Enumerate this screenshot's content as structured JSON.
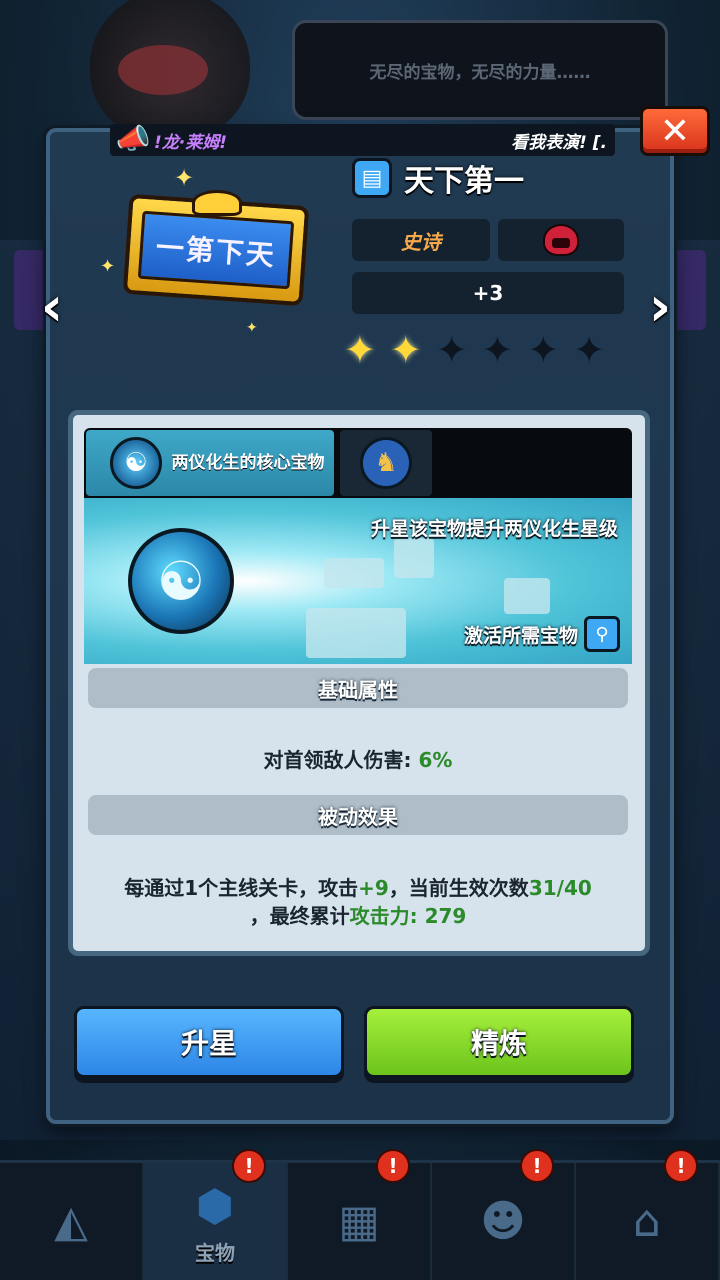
{
  "background": {
    "speech_text": "无尽的宝物，无尽的力量……"
  },
  "ticker": {
    "left_text": "!龙·莱姆!",
    "right_text": "看我表演! [."
  },
  "close_label": "✕",
  "treasure": {
    "plaque_text": "一第下天",
    "name": "天下第一",
    "rarity": "史诗",
    "level": "+3",
    "stars_on": 2,
    "stars_total": 6
  },
  "tabs": [
    {
      "label": "两仪化生的核心宝物",
      "icon": "yin-yang-icon"
    },
    {
      "label": "",
      "icon": "deer-icon"
    }
  ],
  "banner": {
    "upgrade_text": "升星该宝物提升两仪化生星级",
    "activate_text": "激活所需宝物"
  },
  "sections": {
    "base_title": "基础属性",
    "base_stat_label": "对首领敌人伤害:",
    "base_stat_value": "6%",
    "passive_title": "被动效果",
    "passive_line1_a": "每通过1个主线关卡，攻击",
    "passive_line1_b": "+9",
    "passive_line1_c": "，当前生效次数",
    "passive_line1_d": "31/40",
    "passive_line2_a": "，最终累计",
    "passive_line2_b": "攻击力: 279"
  },
  "buttons": {
    "star_up": "升星",
    "refine": "精炼"
  },
  "bottom_nav": [
    {
      "label": "",
      "icon": "crystal-icon",
      "badge": ""
    },
    {
      "label": "宝物",
      "icon": "treasure-shield-icon",
      "badge": "!"
    },
    {
      "label": "",
      "icon": "map-icon",
      "badge": "!"
    },
    {
      "label": "",
      "icon": "hero-icon",
      "badge": "!"
    },
    {
      "label": "",
      "icon": "shop-icon",
      "badge": "!"
    }
  ],
  "colors": {
    "accent_blue": "#3fa8f5",
    "accent_green": "#6cc41c",
    "rarity_orange": "#f5a94a",
    "value_green": "#2b8a2a",
    "close_red": "#d8331c"
  }
}
